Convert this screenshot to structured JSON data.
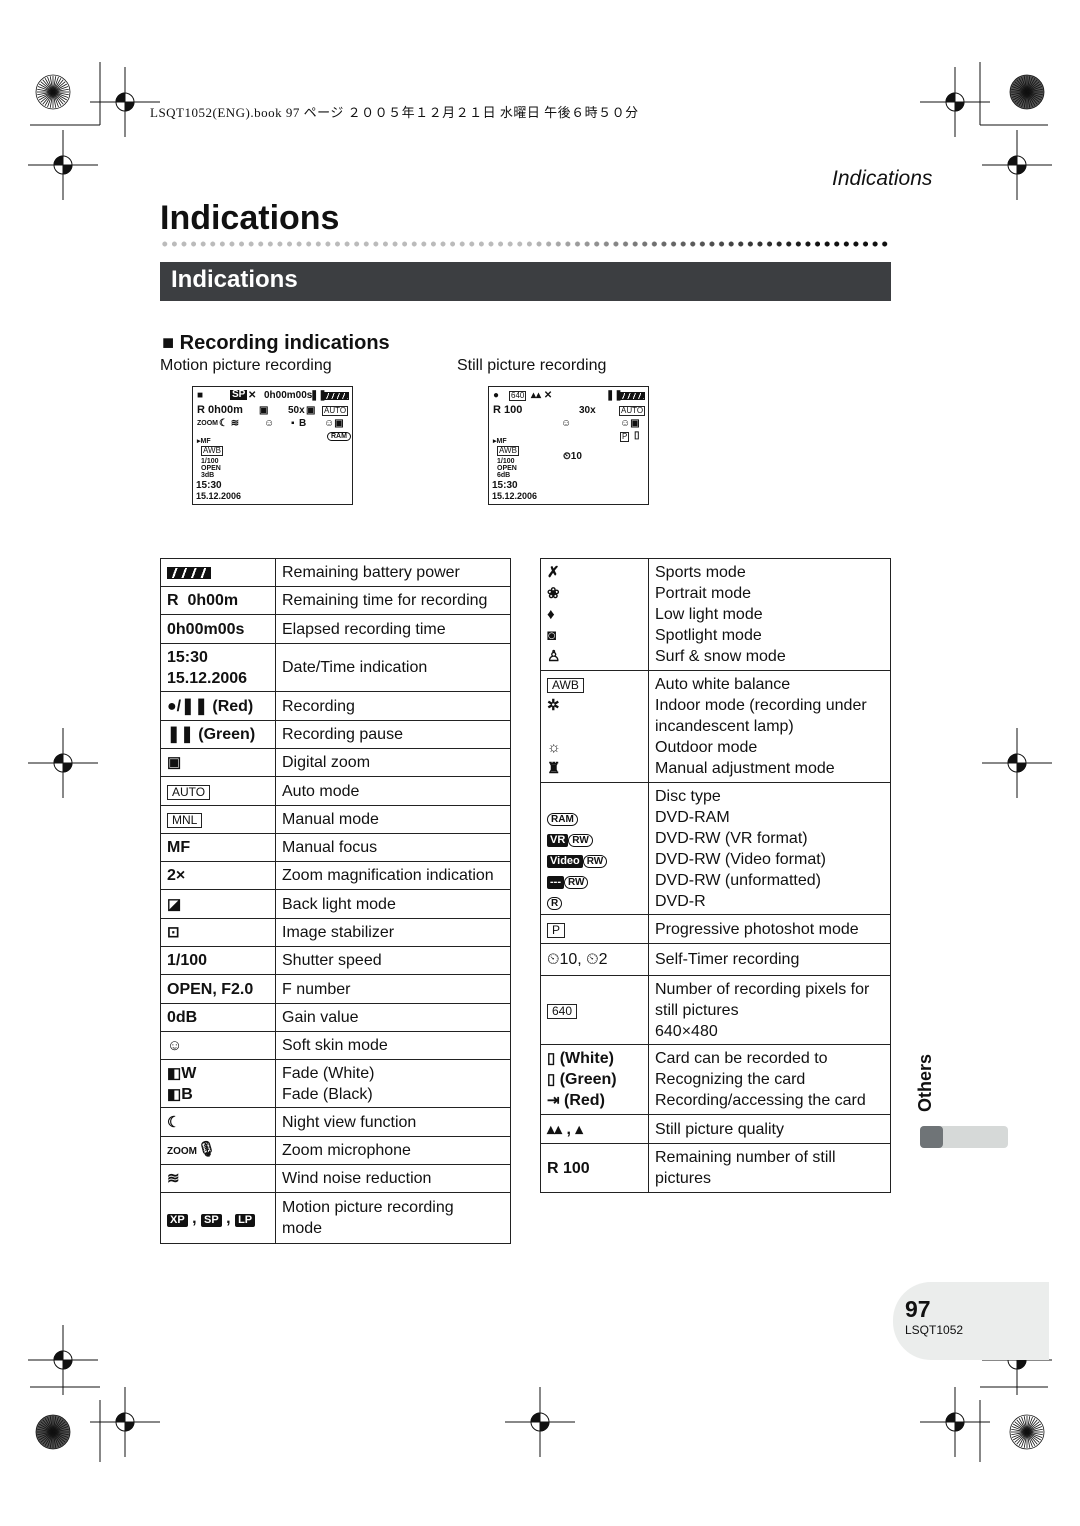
{
  "header": {
    "file_info": "LSQT1052(ENG).book  97 ページ  ２００５年１２月２１日  水曜日  午後６時５０分",
    "running_title": "Indications"
  },
  "page_title": "Indications",
  "section_bar": "Indications",
  "section": {
    "heading": "Recording indications",
    "motion_label": "Motion picture recording",
    "still_label": "Still picture recording"
  },
  "lcd_motion": {
    "mode": "SP",
    "elapsed": "0h00m00s",
    "remaining": "R 0h00m",
    "zoom": "50x",
    "auto": "AUTO",
    "zoom_mic": "ZOOM",
    "fade": "B",
    "mf": "▸MF",
    "awb": "AWB",
    "shutter": "1/100",
    "f": "OPEN",
    "gain": "3dB",
    "time": "15:30",
    "date": "15.12.2006",
    "disc": "RAM"
  },
  "lcd_still": {
    "pixels": "640",
    "remaining": "R 100",
    "zoom": "30x",
    "auto": "AUTO",
    "p": "P",
    "mf": "▸MF",
    "awb": "AWB",
    "timer": "⏲10",
    "shutter": "1/100",
    "f": "OPEN",
    "gain": "6dB",
    "time": "15:30",
    "date": "15.12.2006"
  },
  "left_table": [
    {
      "icon": [
        {
          "i": "battery-icon"
        }
      ],
      "desc": [
        "Remaining battery power"
      ]
    },
    {
      "icon": [
        {
          "t": "R  0h00m"
        }
      ],
      "desc": [
        "Remaining time for recording"
      ]
    },
    {
      "icon": [
        {
          "t": "0h00m00s"
        }
      ],
      "desc": [
        "Elapsed recording time"
      ]
    },
    {
      "icon": [
        {
          "t": "15:30"
        },
        {
          "br": 1
        },
        {
          "t": "15.12.2006"
        }
      ],
      "desc": [
        "Date/Time indication"
      ]
    },
    {
      "icon": [
        {
          "t": "●/❚❚ (Red)"
        }
      ],
      "desc": [
        "Recording"
      ]
    },
    {
      "icon": [
        {
          "t": "❚❚ (Green)"
        }
      ],
      "desc": [
        "Recording pause"
      ]
    },
    {
      "icon": [
        {
          "i": "digital-zoom-icon"
        }
      ],
      "desc": [
        "Digital zoom"
      ]
    },
    {
      "icon": [
        {
          "b": "AUTO"
        }
      ],
      "desc": [
        "Auto mode"
      ]
    },
    {
      "icon": [
        {
          "b": "MNL"
        }
      ],
      "desc": [
        "Manual mode"
      ]
    },
    {
      "icon": [
        {
          "t": "MF"
        }
      ],
      "desc": [
        "Manual focus"
      ]
    },
    {
      "icon": [
        {
          "t": "2×"
        }
      ],
      "desc": [
        "Zoom magnification indication"
      ]
    },
    {
      "icon": [
        {
          "i": "back-light-icon"
        }
      ],
      "desc": [
        "Back light mode"
      ]
    },
    {
      "icon": [
        {
          "i": "image-stabilizer-icon"
        }
      ],
      "desc": [
        "Image stabilizer"
      ]
    },
    {
      "icon": [
        {
          "t": "1/100"
        }
      ],
      "desc": [
        "Shutter speed"
      ]
    },
    {
      "icon": [
        {
          "t": "OPEN, F2.0"
        }
      ],
      "desc": [
        "F number"
      ]
    },
    {
      "icon": [
        {
          "t": "0dB"
        }
      ],
      "desc": [
        "Gain value"
      ]
    },
    {
      "icon": [
        {
          "i": "soft-skin-icon"
        }
      ],
      "desc": [
        "Soft skin mode"
      ]
    },
    {
      "icon": [
        {
          "i": "fade-icon"
        },
        {
          "t": "W"
        },
        {
          "br": 1
        },
        {
          "i": "fade-icon"
        },
        {
          "t": "B"
        }
      ],
      "desc": [
        "Fade (White)",
        "Fade (Black)"
      ]
    },
    {
      "icon": [
        {
          "i": "night-view-icon"
        }
      ],
      "desc": [
        "Night view function"
      ]
    },
    {
      "icon": [
        {
          "s": "ZOOM"
        },
        {
          "i": "microphone-icon"
        }
      ],
      "desc": [
        "Zoom microphone"
      ]
    },
    {
      "icon": [
        {
          "i": "wind-noise-icon"
        }
      ],
      "desc": [
        "Wind noise reduction"
      ]
    },
    {
      "icon": [
        {
          "k": "XP"
        },
        {
          "t": " , "
        },
        {
          "k": "SP"
        },
        {
          "t": " , "
        },
        {
          "k": "LP"
        }
      ],
      "desc": [
        "Motion picture recording",
        "mode"
      ]
    }
  ],
  "right_table": [
    {
      "icon": [
        {
          "i": "sports-mode-icon"
        },
        {
          "br": 1
        },
        {
          "i": "portrait-mode-icon"
        },
        {
          "br": 1
        },
        {
          "i": "low-light-icon"
        },
        {
          "br": 1
        },
        {
          "i": "spotlight-icon"
        },
        {
          "br": 1
        },
        {
          "i": "surf-snow-icon"
        }
      ],
      "desc": [
        "Sports mode",
        "Portrait mode",
        "Low light mode",
        "Spotlight mode",
        "Surf & snow mode"
      ]
    },
    {
      "icon": [
        {
          "b": "AWB"
        },
        {
          "br": 1
        },
        {
          "i": "indoor-mode-icon"
        },
        {
          "br": 1
        },
        {
          "br": 1
        },
        {
          "i": "outdoor-mode-icon"
        },
        {
          "br": 1
        },
        {
          "i": "manual-white-balance-icon"
        }
      ],
      "desc": [
        "Auto white balance",
        "Indoor mode (recording under",
        "incandescent lamp)",
        "Outdoor mode",
        "Manual adjustment mode"
      ]
    },
    {
      "icon": [
        {
          "br": 1
        },
        {
          "o": "RAM"
        },
        {
          "br": 1
        },
        {
          "k": "VR"
        },
        {
          "o": "RW"
        },
        {
          "br": 1
        },
        {
          "k": "Video"
        },
        {
          "o": "RW"
        },
        {
          "br": 1
        },
        {
          "k": "---"
        },
        {
          "o": "RW"
        },
        {
          "br": 1
        },
        {
          "o": "R"
        }
      ],
      "desc": [
        "Disc type",
        "DVD-RAM",
        "DVD-RW (VR format)",
        "DVD-RW (Video format)",
        "DVD-RW (unformatted)",
        "DVD-R"
      ]
    },
    {
      "icon": [
        {
          "b": "P"
        }
      ],
      "desc": [
        "Progressive photoshot mode"
      ]
    },
    {
      "icon": [
        {
          "n": "⏲10, ⏲2"
        }
      ],
      "desc": [
        "Self-Timer recording"
      ]
    },
    {
      "icon": [
        {
          "b": "640"
        }
      ],
      "desc": [
        "Number of recording pixels for",
        "still pictures",
        "640×480"
      ]
    },
    {
      "icon": [
        {
          "i": "card-icon"
        },
        {
          "t": " (White)"
        },
        {
          "br": 1
        },
        {
          "i": "card-icon"
        },
        {
          "t": " (Green)"
        },
        {
          "br": 1
        },
        {
          "i": "card-access-icon"
        },
        {
          "t": " (Red)"
        }
      ],
      "desc": [
        "Card can be recorded to",
        "Recognizing the card",
        "Recording/accessing the card"
      ]
    },
    {
      "icon": [
        {
          "i": "quality-fine-icon"
        },
        {
          "t": " , "
        },
        {
          "i": "quality-normal-icon"
        }
      ],
      "desc": [
        "Still picture quality"
      ]
    },
    {
      "icon": [
        {
          "t": "R 100"
        }
      ],
      "desc": [
        "Remaining number of still",
        "pictures"
      ]
    }
  ],
  "sidebar": {
    "tab_label": "Others"
  },
  "footer": {
    "page_number": "97",
    "code": "LSQT1052"
  }
}
